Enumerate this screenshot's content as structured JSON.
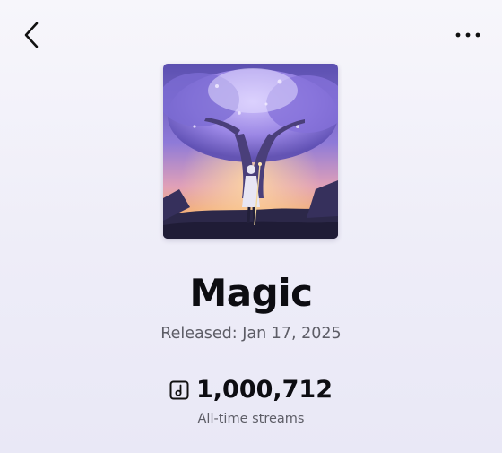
{
  "nav": {
    "back_icon": "chevron-left-icon",
    "more_icon": "more-horizontal-icon"
  },
  "song": {
    "title": "Magic",
    "released": "Released: Jan 17, 2025",
    "cover_art": "album-cover-image",
    "streams_icon": "music-note-box-icon",
    "streams_count": "1,000,712",
    "streams_label": "All-time streams"
  },
  "colors": {
    "background": "#f1f0f9",
    "title": "#0d0d12",
    "secondary_text": "#5d5d66"
  }
}
